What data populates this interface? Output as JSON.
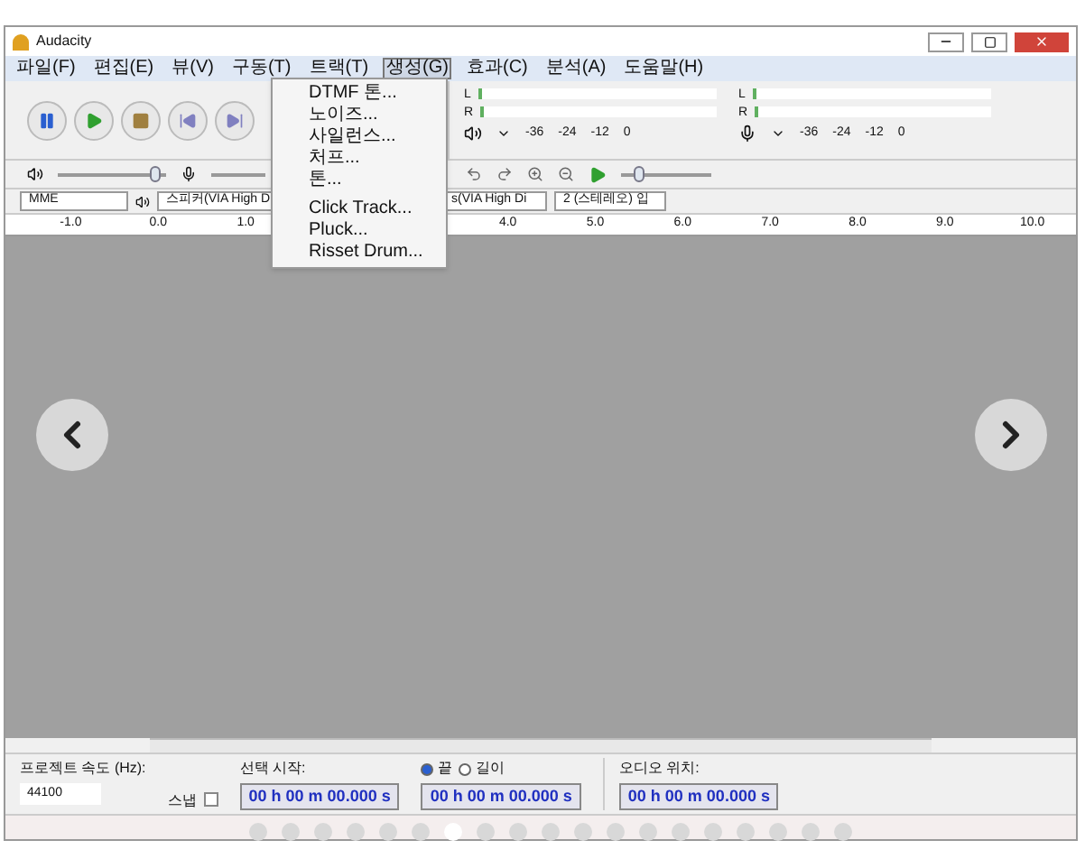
{
  "window": {
    "title": "Audacity"
  },
  "menu": [
    {
      "label": "파일(F)",
      "selected": false
    },
    {
      "label": "편집(E)",
      "selected": false
    },
    {
      "label": "뷰(V)",
      "selected": false
    },
    {
      "label": "구동(T)",
      "selected": false
    },
    {
      "label": "트랙(T)",
      "selected": false
    },
    {
      "label": "생성(G)",
      "selected": true
    },
    {
      "label": "효과(C)",
      "selected": false
    },
    {
      "label": "분석(A)",
      "selected": false
    },
    {
      "label": "도움말(H)",
      "selected": false
    }
  ],
  "open_menu": [
    "DTMF 톤...",
    "노이즈...",
    "사일런스...",
    "처프...",
    "톤...",
    "Click Track...",
    "Pluck...",
    "Risset Drum..."
  ],
  "meters": [
    {
      "kind": "playback",
      "channels": [
        "L",
        "R"
      ],
      "ticks": [
        "-36",
        "-24",
        "-12",
        "0"
      ]
    },
    {
      "kind": "recording",
      "channels": [
        "L",
        "R"
      ],
      "ticks": [
        "-36",
        "-24",
        "-12",
        "0"
      ]
    }
  ],
  "device_toolbar": {
    "host": "MME",
    "output": "스피커(VIA High D",
    "input": "s(VIA High Di",
    "channels": "2 (스테레오) 입"
  },
  "sliders": {
    "playback_volume": {
      "level": 0.9
    },
    "play_speed": {
      "level": 0.2
    }
  },
  "ruler": {
    "left_labels": [
      "-1.0",
      "0.0",
      "1.0"
    ],
    "right_labels": [
      "4.0",
      "5.0",
      "6.0",
      "7.0",
      "8.0",
      "9.0",
      "10.0"
    ]
  },
  "selection_bar": {
    "rate_label": "프로젝트 속도 (Hz):",
    "rate_value": "44100",
    "snap_label": "스냅",
    "snap_checked": false,
    "start_label": "선택 시작:",
    "end_options": [
      {
        "label": "끝",
        "selected": true
      },
      {
        "label": "길이",
        "selected": false
      }
    ],
    "start_time": "00 h 00 m 00.000 s",
    "end_time": "00 h 00 m 00.000 s",
    "position_label": "오디오 위치:",
    "position_time": "00 h 00 m 00.000 s"
  },
  "carousel": {
    "dots": [
      {
        "selected": false
      },
      {
        "selected": false
      },
      {
        "selected": false
      },
      {
        "selected": false
      },
      {
        "selected": false
      },
      {
        "selected": false
      },
      {
        "selected": true
      },
      {
        "selected": false
      },
      {
        "selected": false
      },
      {
        "selected": false
      },
      {
        "selected": false
      },
      {
        "selected": false
      },
      {
        "selected": false
      },
      {
        "selected": false
      },
      {
        "selected": false
      },
      {
        "selected": false
      },
      {
        "selected": false
      },
      {
        "selected": false
      },
      {
        "selected": false
      }
    ]
  }
}
